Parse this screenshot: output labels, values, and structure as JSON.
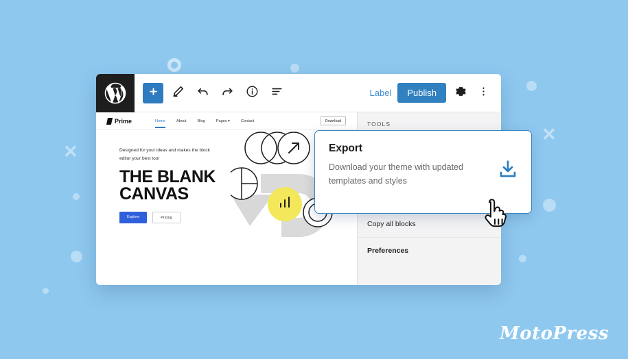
{
  "theme": {
    "background_color": "#8ec8ef",
    "accent_blue": "#2f7bbf",
    "publish_blue": "#3180bf",
    "popup_border_blue": "#3b87c4",
    "yellow": "#f3e85c",
    "dark": "#1e1e1e"
  },
  "editor": {
    "toolbar": {
      "wp_logo": "wordpress-logo",
      "left_tools": [
        {
          "icon": "plus-icon",
          "name": "add-block-button"
        },
        {
          "icon": "pencil-icon",
          "name": "edit-tool-button"
        },
        {
          "icon": "undo-icon",
          "name": "undo-button"
        },
        {
          "icon": "redo-icon",
          "name": "redo-button"
        },
        {
          "icon": "info-icon",
          "name": "details-button"
        },
        {
          "icon": "list-view-icon",
          "name": "list-view-button"
        }
      ],
      "label_text": "Label",
      "publish_label": "Publish",
      "settings_icon": "gear-icon",
      "more_menu_icon": "three-dots-vertical-icon"
    },
    "preview": {
      "site_nav": {
        "logo_text": "Prime",
        "menu_items": [
          {
            "label": "Home",
            "active": true
          },
          {
            "label": "About",
            "active": false
          },
          {
            "label": "Blog",
            "active": false
          },
          {
            "label": "Pages ▾",
            "active": false
          },
          {
            "label": "Contact",
            "active": false
          }
        ],
        "download_button": "Download"
      },
      "hero": {
        "tagline": "Designed for your ideas and makes the block editor your best tool",
        "title_line1": "THE BLANK",
        "title_line2": "CANVAS",
        "primary_button": "Explore",
        "secondary_button": "Pricing",
        "graphic_badge_icon": "bar-chart-icon",
        "graphic_arrow_icon": "arrow-up-right-icon"
      }
    },
    "sidebar": {
      "section_header": "TOOLS",
      "items": [
        {
          "label": "Copy all blocks",
          "bold": false
        },
        {
          "label": "Preferences",
          "bold": true
        }
      ]
    }
  },
  "export_popup": {
    "title": "Export",
    "description": "Download your theme with updated templates and styles",
    "icon": "download-icon"
  },
  "cursor": {
    "icon": "pointing-hand-cursor"
  },
  "brand": {
    "name": "MotoPress"
  }
}
